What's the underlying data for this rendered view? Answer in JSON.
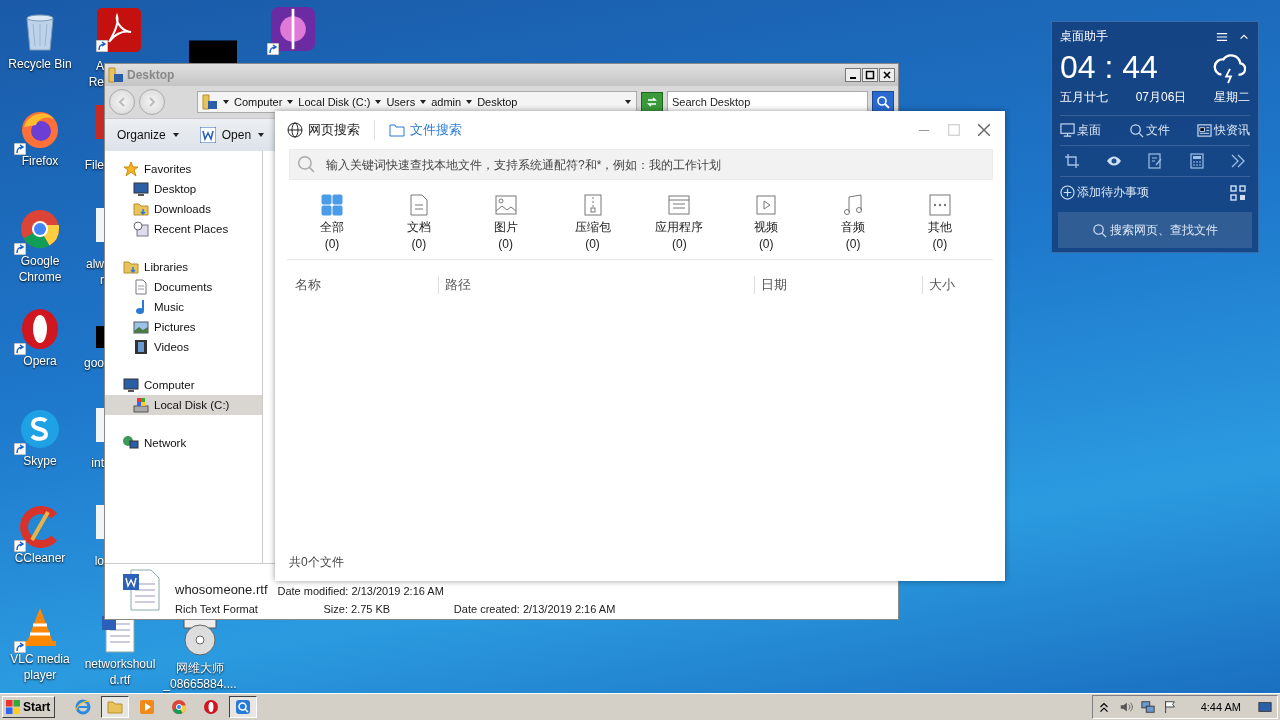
{
  "desktop_icons": [
    {
      "kind": "recycle-bin",
      "label": [
        "Recycle Bin"
      ],
      "shortcut": false
    },
    {
      "kind": "firefox",
      "label": [
        "Firefox"
      ],
      "shortcut": true
    },
    {
      "kind": "chrome",
      "label": [
        "Google",
        "Chrome"
      ],
      "shortcut": true
    },
    {
      "kind": "opera",
      "label": [
        "Opera"
      ],
      "shortcut": true
    },
    {
      "kind": "skype",
      "label": [
        "Skype"
      ],
      "shortcut": true
    },
    {
      "kind": "ccleaner",
      "label": [
        "CCleaner"
      ],
      "shortcut": true
    },
    {
      "kind": "vlc",
      "label": [
        "VLC media",
        "player"
      ],
      "shortcut": true
    },
    {
      "kind": "dark-thumbnail",
      "shortcut": false
    },
    {
      "kind": "picture-app",
      "shortcut": true
    },
    {
      "kind": "document",
      "label": [
        "networkshoul",
        "d.rtf"
      ],
      "shortcut": false
    },
    {
      "kind": "disc",
      "label": [
        "网维大师",
        "_08665884...."
      ],
      "shortcut": false
    }
  ],
  "partial_icons": [
    {
      "kind": "acrobat",
      "label": [
        "A",
        "Re"
      ]
    },
    {
      "kind": "red",
      "label": [
        "File"
      ]
    },
    {
      "kind": "document",
      "label": [
        "alw",
        "r"
      ]
    },
    {
      "kind": "dark",
      "label": [
        "goo"
      ]
    },
    {
      "kind": "document",
      "label": [
        "int"
      ]
    },
    {
      "kind": "document",
      "label": [
        "lo"
      ]
    }
  ],
  "explorer": {
    "title": "Desktop",
    "breadcrumbs": [
      "Computer",
      "Local Disk (C:)",
      "Users",
      "admin",
      "Desktop"
    ],
    "search_placeholder": "Search Desktop",
    "toolbar": [
      {
        "label": "Organize",
        "kind": "menu"
      },
      {
        "label": "Open",
        "kind": "open"
      }
    ],
    "navigation": [
      {
        "label": "Favorites",
        "kind": "favorites",
        "selected": false,
        "children": [
          {
            "label": "Desktop",
            "kind": "desktop",
            "selected": false
          },
          {
            "label": "Downloads",
            "kind": "downloads",
            "selected": false
          },
          {
            "label": "Recent Places",
            "kind": "recent",
            "selected": false
          }
        ]
      },
      {
        "label": "Libraries",
        "kind": "libraries",
        "selected": false,
        "children": [
          {
            "label": "Documents",
            "kind": "documents",
            "selected": false
          },
          {
            "label": "Music",
            "kind": "music",
            "selected": false
          },
          {
            "label": "Pictures",
            "kind": "pictures",
            "selected": false
          },
          {
            "label": "Videos",
            "kind": "videos",
            "selected": false
          }
        ]
      },
      {
        "label": "Computer",
        "kind": "computer",
        "selected": false,
        "children": [
          {
            "label": "Local Disk (C:)",
            "kind": "disk",
            "selected": true
          }
        ]
      },
      {
        "label": "Network",
        "kind": "network",
        "selected": false
      }
    ],
    "details": {
      "file_name": "whosomeone.rtf",
      "file_type": "Rich Text Format",
      "modified": "Date modified: 2/13/2019 2:16 AM",
      "created": "Date created: 2/13/2019 2:16 AM",
      "size": "Size: 2.75 KB"
    }
  },
  "search_window": {
    "tabs": [
      {
        "label": "网页搜索",
        "kind": "web",
        "selected": false
      },
      {
        "label": "文件搜索",
        "kind": "files",
        "selected": true
      }
    ],
    "placeholder": "输入关键词快速查找本地文件，支持系统通配符?和*，例如：我的工作计划",
    "categories": [
      {
        "label": "全部",
        "count": "(0)",
        "kind": "all",
        "selected": true
      },
      {
        "label": "文档",
        "count": "(0)",
        "kind": "document",
        "selected": false
      },
      {
        "label": "图片",
        "count": "(0)",
        "kind": "image",
        "selected": false
      },
      {
        "label": "压缩包",
        "count": "(0)",
        "kind": "archive",
        "selected": false
      },
      {
        "label": "应用程序",
        "count": "(0)",
        "kind": "app",
        "selected": false
      },
      {
        "label": "视频",
        "count": "(0)",
        "kind": "video",
        "selected": false
      },
      {
        "label": "音频",
        "count": "(0)",
        "kind": "audio",
        "selected": false
      },
      {
        "label": "其他",
        "count": "(0)",
        "kind": "other",
        "selected": false
      }
    ],
    "columns": [
      "名称",
      "路径",
      "日期",
      "大小"
    ],
    "footer": "共0个文件"
  },
  "widget": {
    "title": "桌面助手",
    "time": "04 : 44",
    "lunar_date": "五月廿七",
    "date": "07月06日",
    "weekday": "星期二",
    "links": [
      {
        "kind": "desktop",
        "label": "桌面"
      },
      {
        "kind": "search",
        "label": "文件"
      },
      {
        "kind": "news",
        "label": "快资讯"
      }
    ],
    "tools": [
      {
        "kind": "crop"
      },
      {
        "kind": "eye"
      },
      {
        "kind": "note"
      },
      {
        "kind": "calculator"
      },
      {
        "kind": "more"
      }
    ],
    "todo": "添加待办事项",
    "search_button": "搜索网页、查找文件"
  },
  "taskbar": {
    "start": "Start",
    "apps": [
      {
        "kind": "ie",
        "selected": false
      },
      {
        "kind": "explorer",
        "selected": true
      },
      {
        "kind": "media",
        "selected": false
      },
      {
        "kind": "chrome",
        "selected": false
      },
      {
        "kind": "opera",
        "selected": false
      },
      {
        "kind": "search",
        "selected": true
      }
    ],
    "tray": [
      {
        "kind": "chevron"
      },
      {
        "kind": "volume"
      },
      {
        "kind": "network"
      },
      {
        "kind": "flag"
      }
    ],
    "clock": "4:44 AM"
  }
}
